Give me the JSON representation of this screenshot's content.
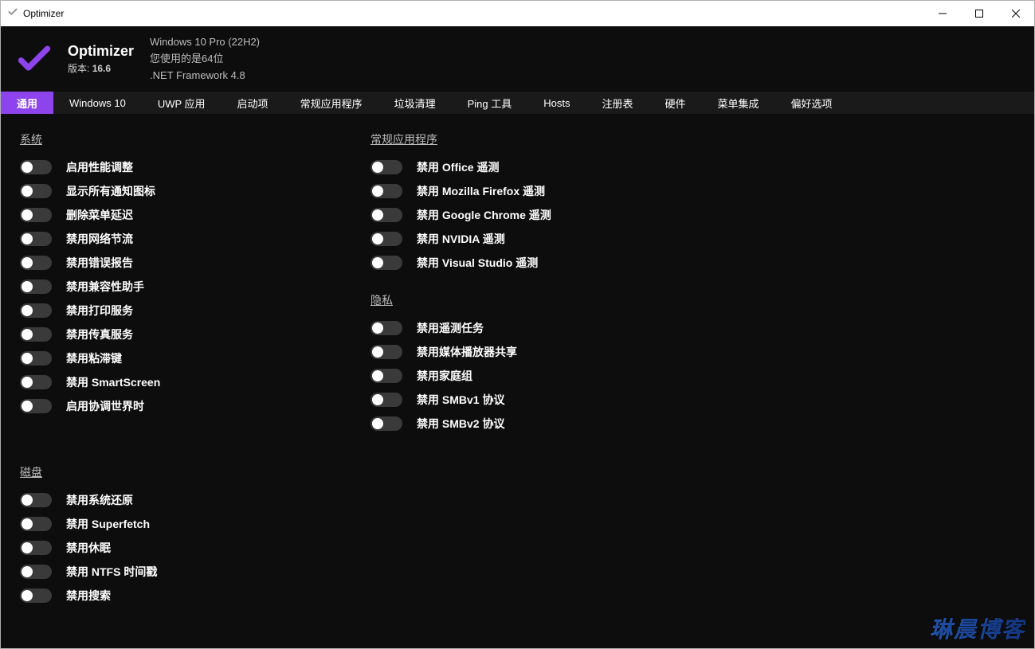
{
  "window": {
    "title": "Optimizer"
  },
  "header": {
    "app_name": "Optimizer",
    "version_label": "版本:",
    "version_value": "16.6",
    "os_line": "Windows 10 Pro (22H2)",
    "arch_line": "您使用的是64位",
    "fw_line": ".NET Framework 4.8"
  },
  "tabs": [
    {
      "label": "通用",
      "active": true
    },
    {
      "label": "Windows 10",
      "active": false
    },
    {
      "label": "UWP 应用",
      "active": false
    },
    {
      "label": "启动项",
      "active": false
    },
    {
      "label": "常规应用程序",
      "active": false
    },
    {
      "label": "垃圾清理",
      "active": false
    },
    {
      "label": "Ping 工具",
      "active": false
    },
    {
      "label": "Hosts",
      "active": false
    },
    {
      "label": "注册表",
      "active": false
    },
    {
      "label": "硬件",
      "active": false
    },
    {
      "label": "菜单集成",
      "active": false
    },
    {
      "label": "偏好选项",
      "active": false
    }
  ],
  "groups": {
    "system": {
      "title": "系统",
      "items": [
        {
          "label": "启用性能调整",
          "on": false
        },
        {
          "label": "显示所有通知图标",
          "on": false
        },
        {
          "label": "删除菜单延迟",
          "on": false
        },
        {
          "label": "禁用网络节流",
          "on": false
        },
        {
          "label": "禁用错误报告",
          "on": false
        },
        {
          "label": "禁用兼容性助手",
          "on": false
        },
        {
          "label": "禁用打印服务",
          "on": false
        },
        {
          "label": "禁用传真服务",
          "on": false
        },
        {
          "label": "禁用粘滞键",
          "on": false
        },
        {
          "label": "禁用 SmartScreen",
          "on": false
        },
        {
          "label": "启用协调世界时",
          "on": false
        }
      ]
    },
    "disk": {
      "title": "磁盘",
      "items": [
        {
          "label": "禁用系统还原",
          "on": false
        },
        {
          "label": "禁用 Superfetch",
          "on": false
        },
        {
          "label": "禁用休眠",
          "on": false
        },
        {
          "label": "禁用 NTFS 时间戳",
          "on": false
        },
        {
          "label": "禁用搜索",
          "on": false
        }
      ]
    },
    "apps": {
      "title": "常规应用程序",
      "items": [
        {
          "label": "禁用 Office 遥测",
          "on": false
        },
        {
          "label": "禁用 Mozilla Firefox 遥测",
          "on": false
        },
        {
          "label": "禁用 Google Chrome 遥测",
          "on": false
        },
        {
          "label": "禁用 NVIDIA 遥测",
          "on": false
        },
        {
          "label": "禁用 Visual Studio 遥测",
          "on": false
        }
      ]
    },
    "privacy": {
      "title": "隐私",
      "items": [
        {
          "label": "禁用遥测任务",
          "on": false
        },
        {
          "label": "禁用媒体播放器共享",
          "on": false
        },
        {
          "label": "禁用家庭组",
          "on": false
        },
        {
          "label": "禁用 SMBv1 协议",
          "on": false
        },
        {
          "label": "禁用 SMBv2 协议",
          "on": false
        }
      ]
    }
  },
  "watermark": "琳晨博客",
  "colors": {
    "accent": "#8e44ec"
  }
}
